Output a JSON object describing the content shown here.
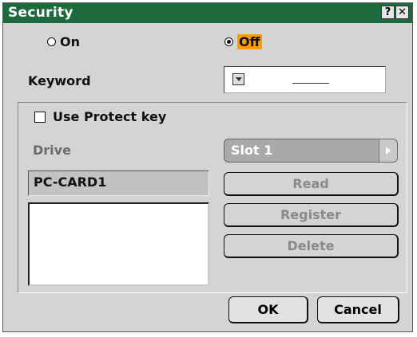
{
  "dialog": {
    "title": "Security",
    "help_button": "?",
    "close_button": "✕"
  },
  "mode": {
    "on_label": "On",
    "off_label": "Off",
    "selected": "Off"
  },
  "keyword": {
    "label": "Keyword",
    "value": ""
  },
  "protect": {
    "checkbox_label": "Use Protect key",
    "checked": false,
    "drive_label": "Drive",
    "drive_value": "Slot 1",
    "card_label": "PC-CARD1",
    "read_label": "Read",
    "register_label": "Register",
    "delete_label": "Delete"
  },
  "footer": {
    "ok_label": "OK",
    "cancel_label": "Cancel"
  },
  "colors": {
    "titlebar": "#1d6a3c",
    "highlight": "#ff9b00",
    "dialog_bg": "#d4d4d4"
  },
  "icons": {
    "help": "question-icon",
    "close": "close-icon",
    "keyword_dropdown": "dropdown-arrow-icon",
    "slot_arrow": "right-arrow-icon"
  }
}
